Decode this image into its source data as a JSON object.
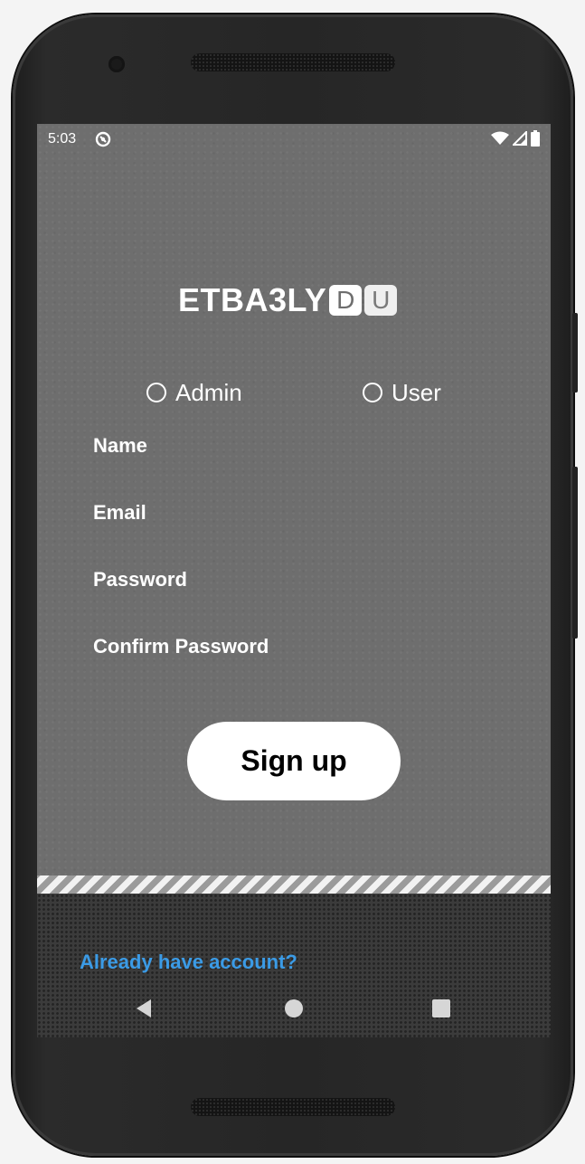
{
  "status_bar": {
    "time": "5:03",
    "icons": [
      "sync-icon",
      "wifi-icon",
      "signal-icon",
      "battery-icon"
    ]
  },
  "logo": {
    "main_text": "ETBA3LY",
    "box_letters": [
      "D",
      "U"
    ]
  },
  "role_selector": {
    "options": [
      {
        "label": "Admin",
        "selected": false
      },
      {
        "label": "User",
        "selected": false
      }
    ]
  },
  "form": {
    "fields": [
      {
        "label": "Name",
        "value": ""
      },
      {
        "label": "Email",
        "value": ""
      },
      {
        "label": "Password",
        "value": ""
      },
      {
        "label": "Confirm Password",
        "value": ""
      }
    ],
    "submit_label": "Sign up"
  },
  "footer": {
    "login_link": "Already have account?"
  },
  "nav_bar": {
    "buttons": [
      "back-icon",
      "home-icon",
      "recents-icon"
    ]
  },
  "colors": {
    "screen_bg": "#6e6e6e",
    "link": "#3b9be6",
    "button_bg": "#ffffff",
    "text": "#ffffff"
  }
}
